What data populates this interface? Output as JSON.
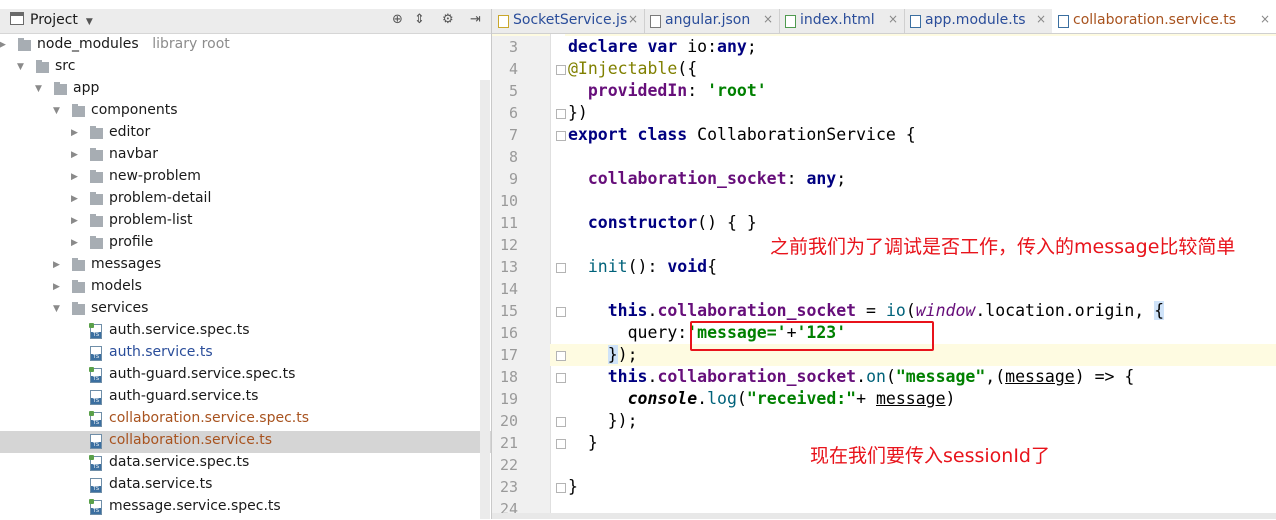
{
  "project_panel": {
    "title": "Project",
    "tree": [
      {
        "label": "node_modules",
        "note": "library root",
        "type": "folder",
        "depth": 3,
        "expanded": false
      },
      {
        "label": "src",
        "type": "folder",
        "depth": 4,
        "expanded": true
      },
      {
        "label": "app",
        "type": "folder",
        "depth": 5,
        "expanded": true
      },
      {
        "label": "components",
        "type": "folder",
        "depth": 6,
        "expanded": true
      },
      {
        "label": "editor",
        "type": "folder",
        "depth": 7,
        "expanded": false
      },
      {
        "label": "navbar",
        "type": "folder",
        "depth": 7,
        "expanded": false
      },
      {
        "label": "new-problem",
        "type": "folder",
        "depth": 7,
        "expanded": false
      },
      {
        "label": "problem-detail",
        "type": "folder",
        "depth": 7,
        "expanded": false
      },
      {
        "label": "problem-list",
        "type": "folder",
        "depth": 7,
        "expanded": false
      },
      {
        "label": "profile",
        "type": "folder",
        "depth": 7,
        "expanded": false
      },
      {
        "label": "messages",
        "type": "folder",
        "depth": 6,
        "expanded": false
      },
      {
        "label": "models",
        "type": "folder",
        "depth": 6,
        "expanded": false
      },
      {
        "label": "services",
        "type": "folder",
        "depth": 6,
        "expanded": true
      },
      {
        "label": "auth.service.spec.ts",
        "type": "spec",
        "depth": 7,
        "state": "normal"
      },
      {
        "label": "auth.service.ts",
        "type": "ts",
        "depth": 7,
        "state": "modified"
      },
      {
        "label": "auth-guard.service.spec.ts",
        "type": "spec",
        "depth": 7,
        "state": "normal"
      },
      {
        "label": "auth-guard.service.ts",
        "type": "ts",
        "depth": 7,
        "state": "normal"
      },
      {
        "label": "collaboration.service.spec.ts",
        "type": "spec",
        "depth": 7,
        "state": "conflict"
      },
      {
        "label": "collaboration.service.ts",
        "type": "ts",
        "depth": 7,
        "state": "conflict",
        "selected": true
      },
      {
        "label": "data.service.spec.ts",
        "type": "spec",
        "depth": 7,
        "state": "normal"
      },
      {
        "label": "data.service.ts",
        "type": "ts",
        "depth": 7,
        "state": "normal"
      },
      {
        "label": "message.service.spec.ts",
        "type": "spec",
        "depth": 7,
        "state": "normal"
      }
    ]
  },
  "tabs": [
    {
      "label": "SocketService.js",
      "icon": "js-file-icon",
      "active": false
    },
    {
      "label": "angular.json",
      "icon": "json-file-icon",
      "active": false
    },
    {
      "label": "index.html",
      "icon": "html-file-icon",
      "active": false
    },
    {
      "label": "app.module.ts",
      "icon": "ts-file-icon",
      "active": false
    },
    {
      "label": "collaboration.service.ts",
      "icon": "ts-file-icon",
      "active": true
    }
  ],
  "editor": {
    "line_numbers": [
      "3",
      "4",
      "5",
      "6",
      "7",
      "8",
      "9",
      "10",
      "11",
      "12",
      "13",
      "14",
      "15",
      "16",
      "17",
      "18",
      "19",
      "20",
      "21",
      "22",
      "23",
      "24"
    ],
    "lines": {
      "l3": [
        "declare",
        " ",
        "var",
        " io:",
        "any",
        ";"
      ],
      "l4": [
        "@Injectable",
        "({"
      ],
      "l5": [
        "  ",
        "providedIn",
        ": ",
        "'root'"
      ],
      "l6": [
        "})"
      ],
      "l7": [
        "export",
        " ",
        "class",
        " CollaborationService {"
      ],
      "l9": [
        "  ",
        "collaboration_socket",
        ": ",
        "any",
        ";"
      ],
      "l11": [
        "  ",
        "constructor",
        "() { }"
      ],
      "l13": [
        "  ",
        "init",
        "(): ",
        "void",
        "{"
      ],
      "l15": [
        "    ",
        "this",
        ".",
        "collaboration_socket",
        " = ",
        "io",
        "(",
        "window",
        ".location.origin, ",
        "{"
      ],
      "l16": [
        "      query:",
        "'message='",
        "+",
        "'123'"
      ],
      "l17": [
        "    ",
        "}",
        ");"
      ],
      "l18": [
        "    ",
        "this",
        ".",
        "collaboration_socket",
        ".",
        "on",
        "(",
        "\"message\"",
        ",(",
        "message",
        ") => {"
      ],
      "l19": [
        "      ",
        "console",
        ".",
        "log",
        "(",
        "\"received:\"",
        "+ ",
        "message",
        ")"
      ],
      "l20": [
        "    });"
      ],
      "l21": [
        "  }"
      ],
      "l23": [
        "}"
      ]
    }
  },
  "annotations": {
    "top": "之前我们为了调试是否工作，传入的message比较简单",
    "bottom": "现在我们要传入sessionId了"
  }
}
